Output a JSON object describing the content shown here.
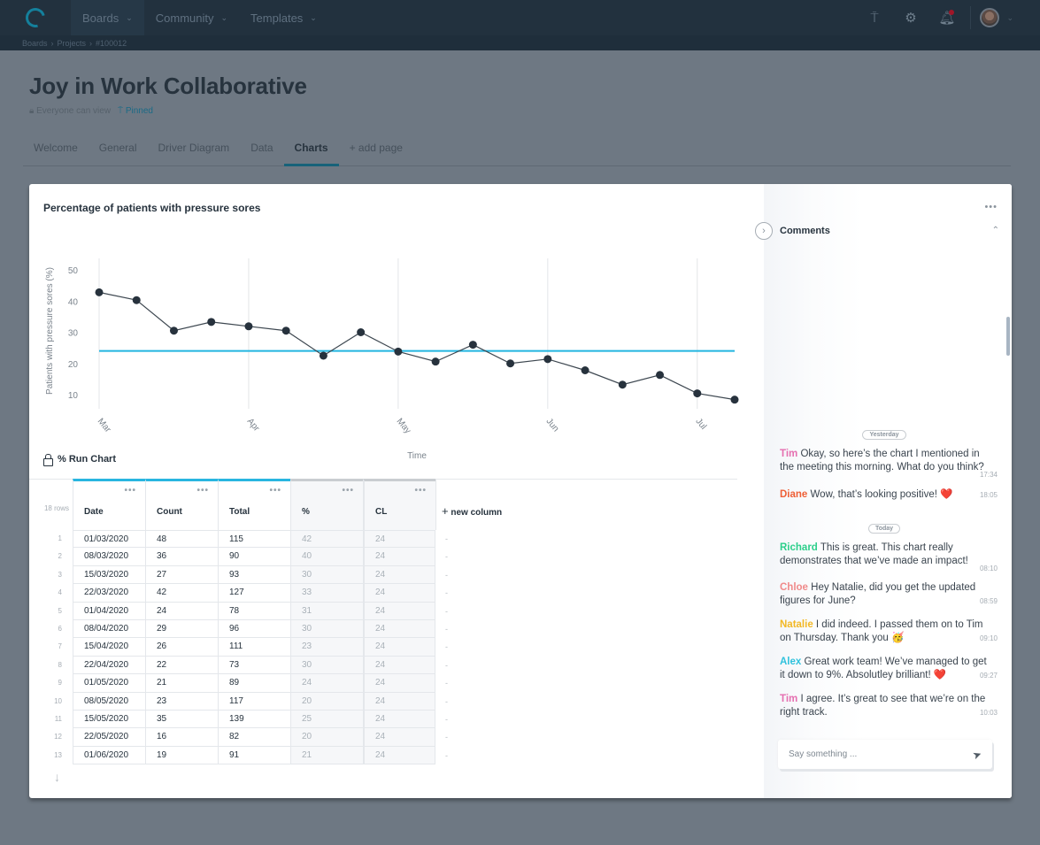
{
  "nav": {
    "items": [
      {
        "label": "Boards"
      },
      {
        "label": "Community"
      },
      {
        "label": "Templates"
      }
    ],
    "icons": [
      "pin-icon",
      "gear-icon",
      "bell-icon"
    ]
  },
  "breadcrumb": [
    "Boards",
    "Projects",
    "#100012"
  ],
  "page": {
    "title": "Joy in Work Collaborative",
    "visibility": "Everyone can view",
    "pinned": "Pinned",
    "tabs": [
      {
        "label": "Welcome"
      },
      {
        "label": "General"
      },
      {
        "label": "Driver Diagram"
      },
      {
        "label": "Data"
      },
      {
        "label": "Charts",
        "active": true
      },
      {
        "label": "+ add page"
      }
    ]
  },
  "chart_data": {
    "type": "line",
    "title": "Percentage of patients with pressure sores",
    "xlabel": "Time",
    "ylabel": "Patients with pressure sores (%)",
    "ylim": [
      5,
      52
    ],
    "yticks": [
      10,
      20,
      30,
      40,
      50
    ],
    "xtick_labels": [
      "Mar",
      "Apr",
      "May",
      "Jun",
      "Jul"
    ],
    "xtick_index": [
      0,
      4,
      8,
      12,
      16
    ],
    "grid": "vertical",
    "series": [
      {
        "name": "%",
        "color": "#27323d",
        "values": [
          42.8,
          40.3,
          30.5,
          33.3,
          31.9,
          30.5,
          22.5,
          30,
          23.8,
          20.6,
          26,
          20,
          21.4,
          17.8,
          13.2,
          16.3,
          10.4,
          8.4
        ]
      },
      {
        "name": "CL",
        "color": "#22b5e0",
        "values": [
          24
        ]
      }
    ]
  },
  "runchart": {
    "title": "% Run Chart",
    "row_count": "18 rows",
    "columns": [
      "Date",
      "Count",
      "Total",
      "%",
      "CL"
    ],
    "new_column": "new column",
    "rows": [
      [
        "01/03/2020",
        "48",
        "115",
        "42",
        "24"
      ],
      [
        "08/03/2020",
        "36",
        "90",
        "40",
        "24"
      ],
      [
        "15/03/2020",
        "27",
        "93",
        "30",
        "24"
      ],
      [
        "22/03/2020",
        "42",
        "127",
        "33",
        "24"
      ],
      [
        "01/04/2020",
        "24",
        "78",
        "31",
        "24"
      ],
      [
        "08/04/2020",
        "29",
        "96",
        "30",
        "24"
      ],
      [
        "15/04/2020",
        "26",
        "111",
        "23",
        "24"
      ],
      [
        "22/04/2020",
        "22",
        "73",
        "30",
        "24"
      ],
      [
        "01/05/2020",
        "21",
        "89",
        "24",
        "24"
      ],
      [
        "08/05/2020",
        "23",
        "117",
        "20",
        "24"
      ],
      [
        "15/05/2020",
        "35",
        "139",
        "25",
        "24"
      ],
      [
        "22/05/2020",
        "16",
        "82",
        "20",
        "24"
      ],
      [
        "01/06/2020",
        "19",
        "91",
        "21",
        "24"
      ]
    ]
  },
  "comments": {
    "title": "Comments",
    "day_labels": [
      "Yesterday",
      "Today"
    ],
    "messages": [
      {
        "author": "Tim",
        "color": "#e56fb0",
        "text": "Okay, so here’s the chart I mentioned in the meeting this morning. What do you think?",
        "time": "17:34"
      },
      {
        "author": "Diane",
        "color": "#ee5f36",
        "text": "Wow, that’s looking positive! ❤️",
        "time": "18:05"
      },
      {
        "author": "Richard",
        "color": "#2dcf8b",
        "text": "This is great. This chart really demonstrates that we’ve made an impact!",
        "time": "08:10"
      },
      {
        "author": "Chloe",
        "color": "#f08a8a",
        "text": "Hey Natalie, did you get the updated figures for June?",
        "time": "08:59"
      },
      {
        "author": "Natalie",
        "color": "#f2b825",
        "text": "I did indeed. I passed them on to Tim on Thursday. Thank you 🥳",
        "time": "09:10"
      },
      {
        "author": "Alex",
        "color": "#2fc2dd",
        "text": "Great work team! We’ve managed to get it down to 9%. Absolutley brilliant! ❤️",
        "time": "09:27"
      },
      {
        "author": "Tim",
        "color": "#e56fb0",
        "text": "I agree. It’s great to see that we’re on the right track.",
        "time": "10:03"
      }
    ],
    "input_placeholder": "Say something ..."
  }
}
